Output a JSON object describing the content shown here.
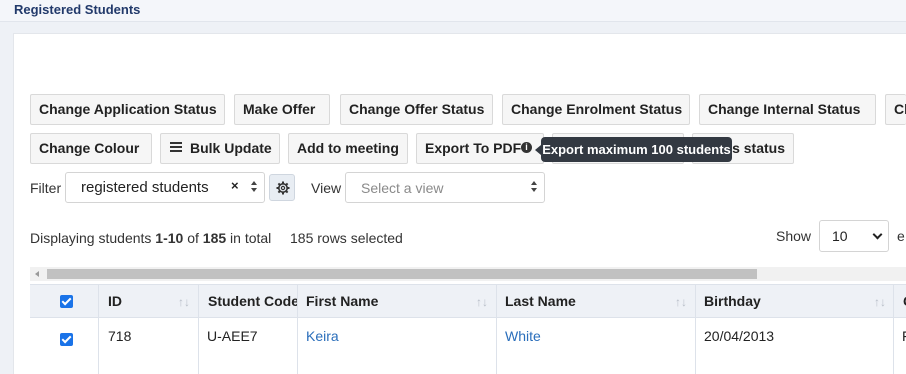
{
  "page": {
    "title": "Registered Students"
  },
  "toolbar": {
    "row1": [
      "Change Application Status",
      "Make Offer",
      "Change Offer Status",
      "Change Enrolment Status",
      "Change Internal Status",
      "Ch"
    ],
    "row2": [
      "Change Colour",
      "Bulk Update",
      "Add to meeting",
      "Export To PDF",
      "s status"
    ]
  },
  "tooltip": {
    "text": "Export maximum 100 students"
  },
  "filter": {
    "label": "Filter",
    "value": "registered students",
    "clear": "×"
  },
  "view": {
    "label": "View",
    "placeholder": "Select a view"
  },
  "summary": {
    "prefix": "Displaying students ",
    "range": "1-10",
    "of": " of ",
    "total": "185",
    "suffix": " in total",
    "selected": "185 rows selected"
  },
  "show": {
    "label": "Show",
    "value": "10",
    "trailing": "e"
  },
  "table": {
    "columns": [
      "ID",
      "Student Code",
      "First Name",
      "Last Name",
      "Birthday",
      "G"
    ],
    "rows": [
      {
        "id": "718",
        "code": "U-AEE7",
        "first": "Keira",
        "last": "White",
        "birthday": "20/04/2013",
        "g": "F"
      }
    ]
  },
  "colors": {
    "accent": "#1a73e8",
    "link": "#2a6ebb",
    "title": "#223a6b",
    "tooltip_bg": "#333942"
  }
}
